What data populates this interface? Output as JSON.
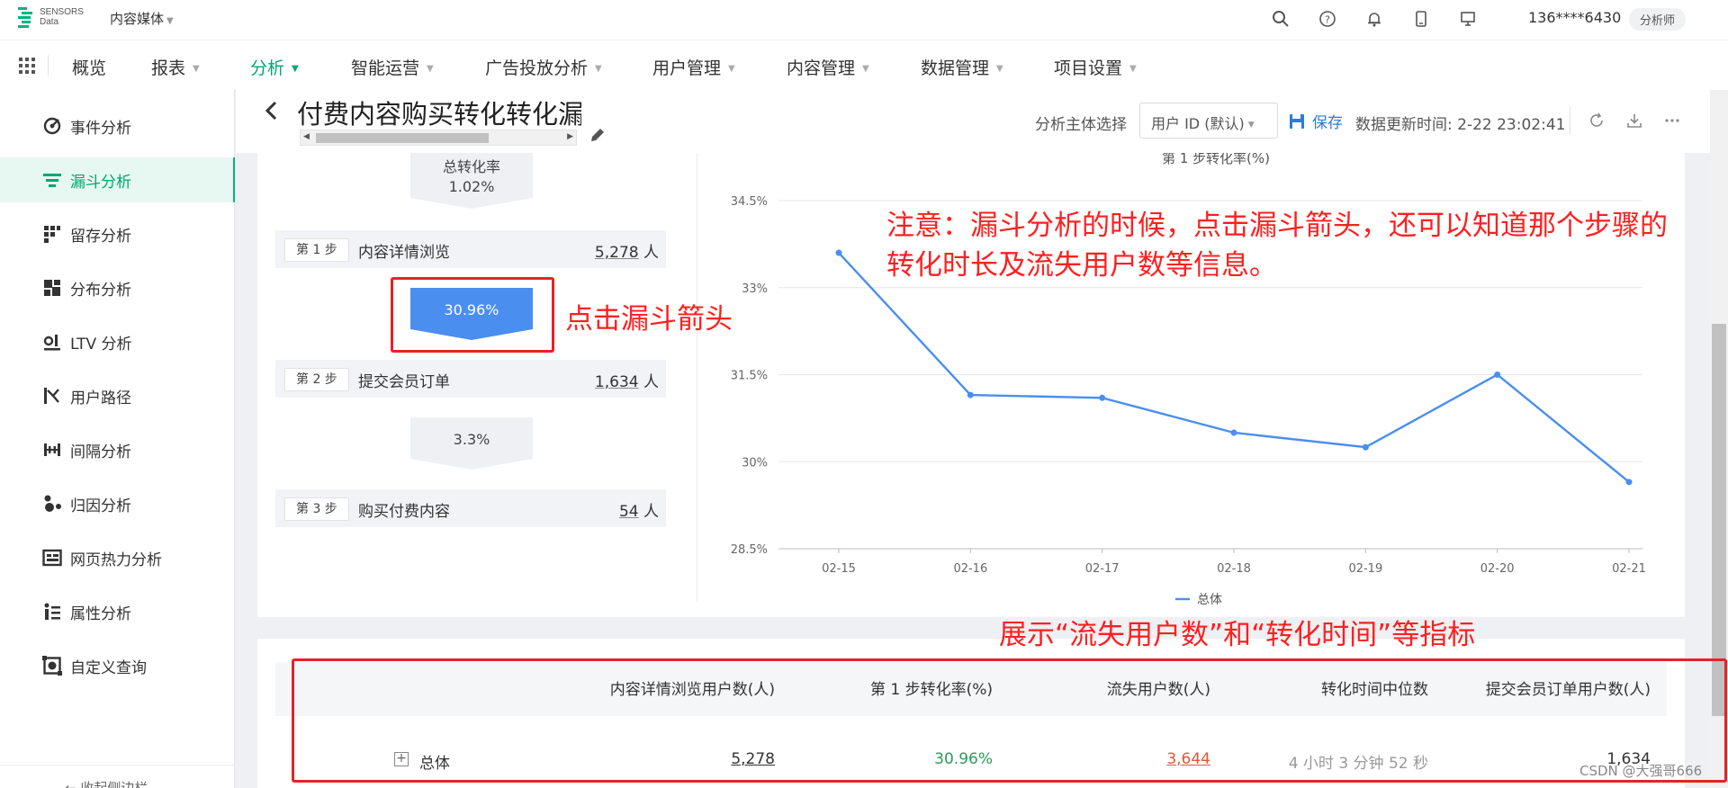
{
  "topbar": {
    "logo_line1": "SENSORS",
    "logo_line2": "Data",
    "project": "内容媒体",
    "user": "136****6430",
    "role": "分析师"
  },
  "nav": {
    "items": [
      "概览",
      "报表",
      "分析",
      "智能运营",
      "广告投放分析",
      "用户管理",
      "内容管理",
      "数据管理",
      "项目设置"
    ],
    "active": "分析"
  },
  "sidebar": {
    "items": [
      "事件分析",
      "漏斗分析",
      "留存分析",
      "分布分析",
      "LTV 分析",
      "用户路径",
      "间隔分析",
      "归因分析",
      "网页热力分析",
      "属性分析",
      "自定义查询"
    ],
    "active": "漏斗分析",
    "footer": "← 收起侧边栏"
  },
  "header": {
    "title": "付费内容购买转化转化漏斗",
    "subject_label": "分析主体选择",
    "subject_value": "用户 ID (默认)",
    "save": "保存",
    "update_time": "数据更新时间: 2-22 23:02:41"
  },
  "funnel": {
    "total_label": "总转化率",
    "total_rate": "1.02%",
    "steps": [
      {
        "badge": "第 1 步",
        "name": "内容详情浏览",
        "count": "5,278",
        "unit": "人"
      },
      {
        "badge": "第 2 步",
        "name": "提交会员订单",
        "count": "1,634",
        "unit": "人"
      },
      {
        "badge": "第 3 步",
        "name": "购买付费内容",
        "count": "54",
        "unit": "人"
      }
    ],
    "arrows": [
      "30.96%",
      "3.3%"
    ]
  },
  "annotations": {
    "click_arrow": "点击漏斗箭头",
    "note_line1": "注意：漏斗分析的时候，点击漏斗箭头，还可以知道那个步骤的",
    "note_line2": "转化时长及流失用户数等信息。",
    "table_note": "展示“流失用户数”和“转化时间”等指标"
  },
  "chart_data": {
    "type": "line",
    "title": "第 1 步转化率(%)",
    "x": [
      "02-15",
      "02-16",
      "02-17",
      "02-18",
      "02-19",
      "02-20",
      "02-21"
    ],
    "series": [
      {
        "name": "总体",
        "values": [
          33.6,
          31.15,
          31.1,
          30.5,
          30.25,
          31.5,
          29.65
        ]
      }
    ],
    "ylim": [
      28.5,
      34.5
    ],
    "yticks": [
      "28.5%",
      "30%",
      "31.5%",
      "33%",
      "34.5%"
    ],
    "line_color": "#4a8ef0",
    "grid": true,
    "legend": "bottom"
  },
  "table": {
    "headers": [
      "内容详情浏览用户数(人)",
      "第 1 步转化率(%)",
      "流失用户数(人)",
      "转化时间中位数",
      "提交会员订单用户数(人)"
    ],
    "row": {
      "name": "总体",
      "users": "5,278",
      "rate": "30.96%",
      "lost": "3,644",
      "median": "4 小时 3 分钟 52 秒",
      "next": "1,634"
    }
  },
  "watermark": "CSDN @大强哥666"
}
